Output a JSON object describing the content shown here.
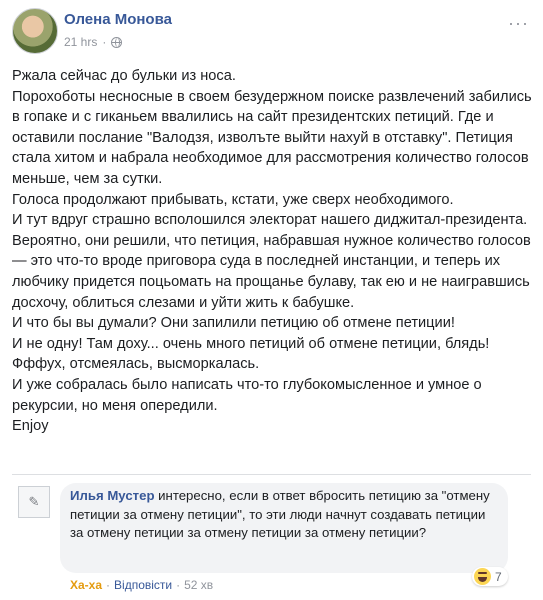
{
  "post": {
    "author": "Олена Монова",
    "time": "21 hrs",
    "meta_separator": "·",
    "more_glyph": "···",
    "text": "Ржала сейчас до бульки из носа.\nПорохоботы несносные в своем безудержном поиске развлечений забились в гопаке и с гиканьем ввалились на сайт президентских петиций. Где и оставили послание \"Валодзя, изволъте выйти нахуй в отставку\". Петиция стала хитом и набрала необходимое для рассмотрения количество голосов меньше, чем за сутки.\nГолоса продолжают прибывать, кстати, уже сверх необходимого.\nИ тут вдруг страшно всполошился электорат нашего диджитал-президента. Вероятно, они решили, что петиция, набравшая нужное количество голосов — это что-то вроде приговора суда в последней инстанции, и теперь их любчику придется поцьомать на прощанье булаву, так ею и не наигравшись досхочу, облиться слезами и уйти жить к бабушке.\nИ что бы вы думали? Они запилили петицию об отмене петиции!\nИ не одну! Там доху... очень много петиций об отмене петиции, блядь!\nФффух, отсмеялась, высморкалась.\nИ уже собралась было написать что-то глубокомысленное и умное о рекурсии, но меня опередили.\nEnjoy"
  },
  "comment": {
    "author": "Илья Мустер",
    "text": " интересно, если в ответ вбросить петицию за \"отмену петиции за отмену петиции\", то эти люди начнут создавать петиции за отмену петиции за отмену петиции за отмену петиции?",
    "reaction_label": "Ха-ха",
    "reply_label": "Відповісти",
    "separator": "·",
    "time": "52 хв",
    "reaction_count": "7"
  },
  "icons": {
    "globe": "globe-icon",
    "more": "more-options-icon",
    "haha": "haha-reaction-icon"
  },
  "colors": {
    "link": "#385898",
    "meta": "#90949c",
    "bubble": "#f2f3f5",
    "haha_text": "#e49b0f"
  }
}
